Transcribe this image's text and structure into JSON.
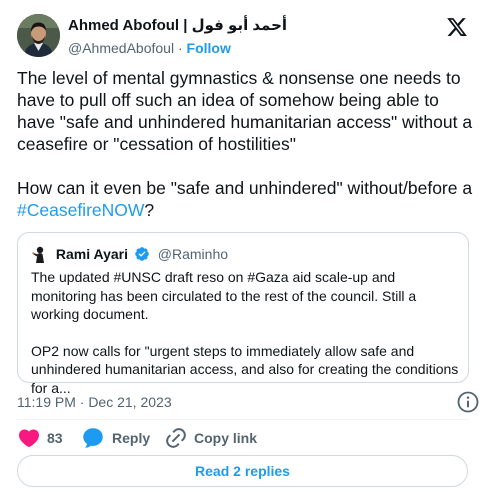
{
  "author": {
    "display_name": "Ahmed Abofoul | أحمد أبو فول",
    "handle": "@AhmedAbofoul",
    "separator": "·",
    "follow_label": "Follow"
  },
  "tweet": {
    "paragraph_1": "The level of mental gymnastics & nonsense one needs to have to pull off such an idea of somehow being able to have \"safe and unhindered humanitarian access\" without a ceasefire or \"cessation of hostilities\"",
    "paragraph_2_prefix": "How can it even be \"safe and unhindered\" without/before a ",
    "hashtag": "#CeasefireNOW",
    "paragraph_2_suffix": "?"
  },
  "quote": {
    "name": "Rami Ayari",
    "handle": "@Raminho",
    "paragraph_1": "The updated #UNSC draft reso on #Gaza aid scale-up and monitoring has been circulated to the rest of the council. Still a working document.",
    "paragraph_2": "OP2 now calls for \"urgent steps to immediately allow safe and unhindered humanitarian access, and also for creating the conditions for a..."
  },
  "timestamp": "11:19 PM · Dec 21, 2023",
  "actions": {
    "like_count": "83",
    "reply_label": "Reply",
    "copy_label": "Copy link"
  },
  "read_replies_label": "Read 2 replies",
  "icons": {
    "x_logo": "x-logo-icon",
    "verified": "verified-badge-icon",
    "info": "info-icon",
    "heart": "heart-icon",
    "reply": "speech-bubble-icon",
    "link": "link-icon"
  },
  "colors": {
    "accent": "#1d9bf0",
    "like": "#f91880",
    "text": "#0f1419",
    "secondary": "#536471",
    "border": "#cfd9de"
  }
}
